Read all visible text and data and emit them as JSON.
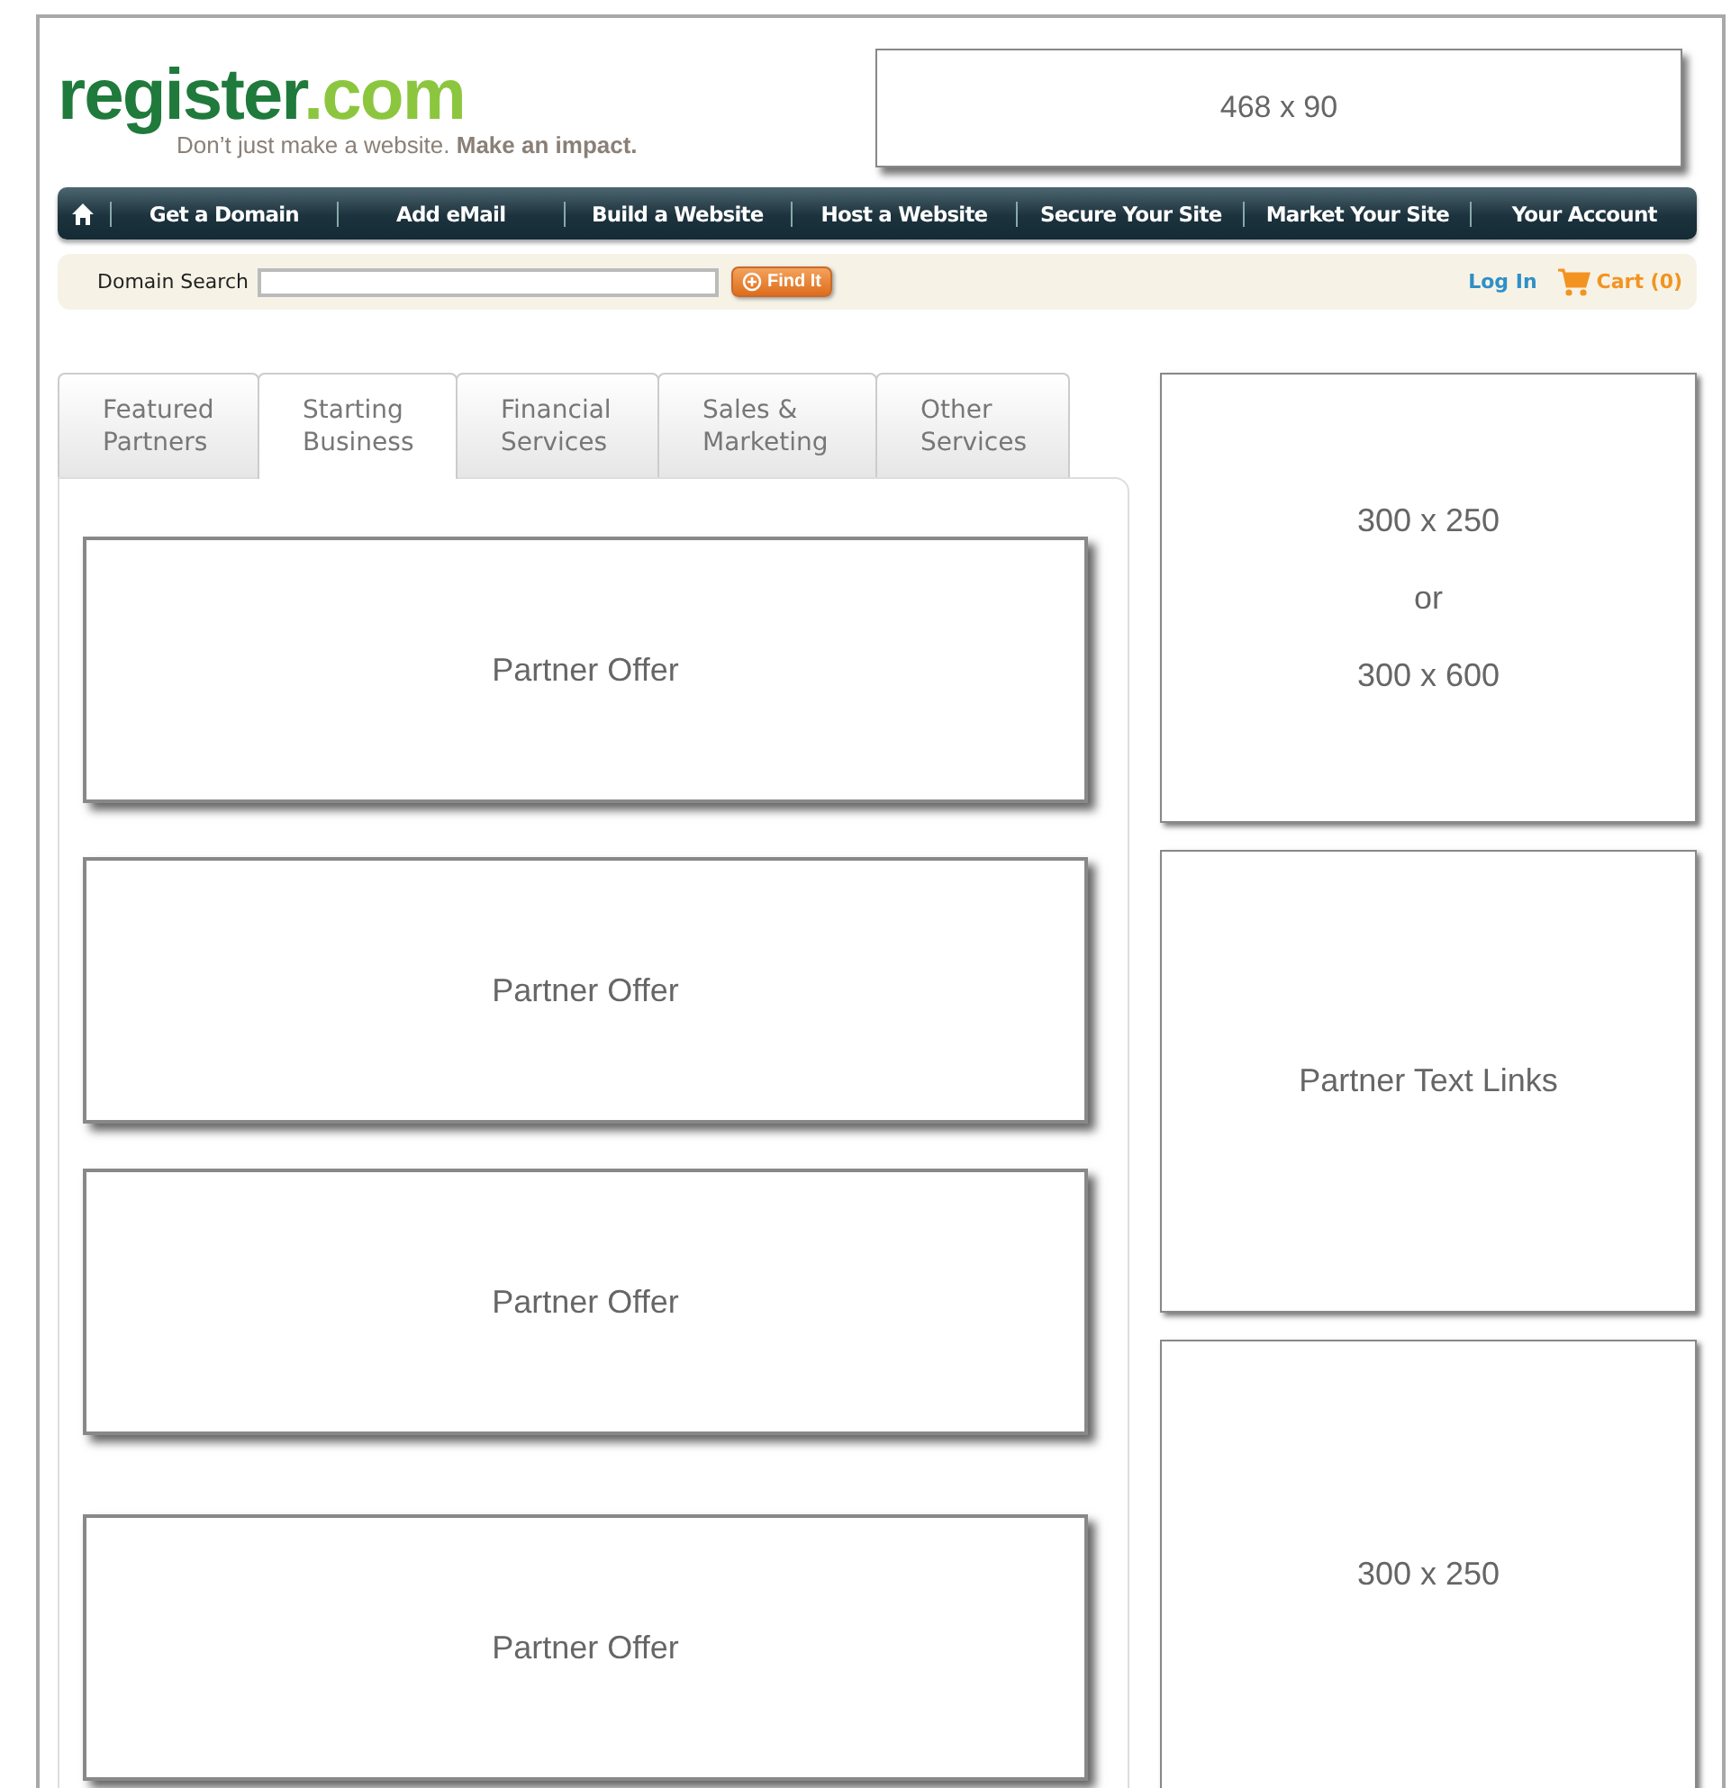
{
  "header": {
    "logo": [
      "register",
      ".com"
    ],
    "tagline": "Don’t just make a website. **Make an impact.**",
    "banner": "468 x 90"
  },
  "nav": {
    "items": [
      "Get a Domain",
      "Add eMail",
      "Build a Website",
      "Host a Website",
      "Secure Your Site",
      "Market Your Site",
      "Your Account"
    ]
  },
  "search": {
    "label": "Domain Search",
    "button": "Find It",
    "login": "Log In",
    "cart": "Cart (0)"
  },
  "tabs": [
    {
      "label": "Featured Partners",
      "selected": false
    },
    {
      "label": "Starting Business",
      "selected": true
    },
    {
      "label": "Financial Services",
      "selected": false
    },
    {
      "label": "Sales & Marketing",
      "selected": false
    },
    {
      "label": "Other Services",
      "selected": false
    }
  ],
  "offers": [
    "Partner Offer",
    "Partner Offer",
    "Partner Offer",
    "Partner Offer"
  ],
  "sidebar": [
    {
      "lines": [
        "300 x 250",
        "or",
        "300 x 600"
      ]
    },
    {
      "lines": [
        "Partner Text Links"
      ]
    },
    {
      "lines": [
        "300 x 250"
      ]
    }
  ]
}
